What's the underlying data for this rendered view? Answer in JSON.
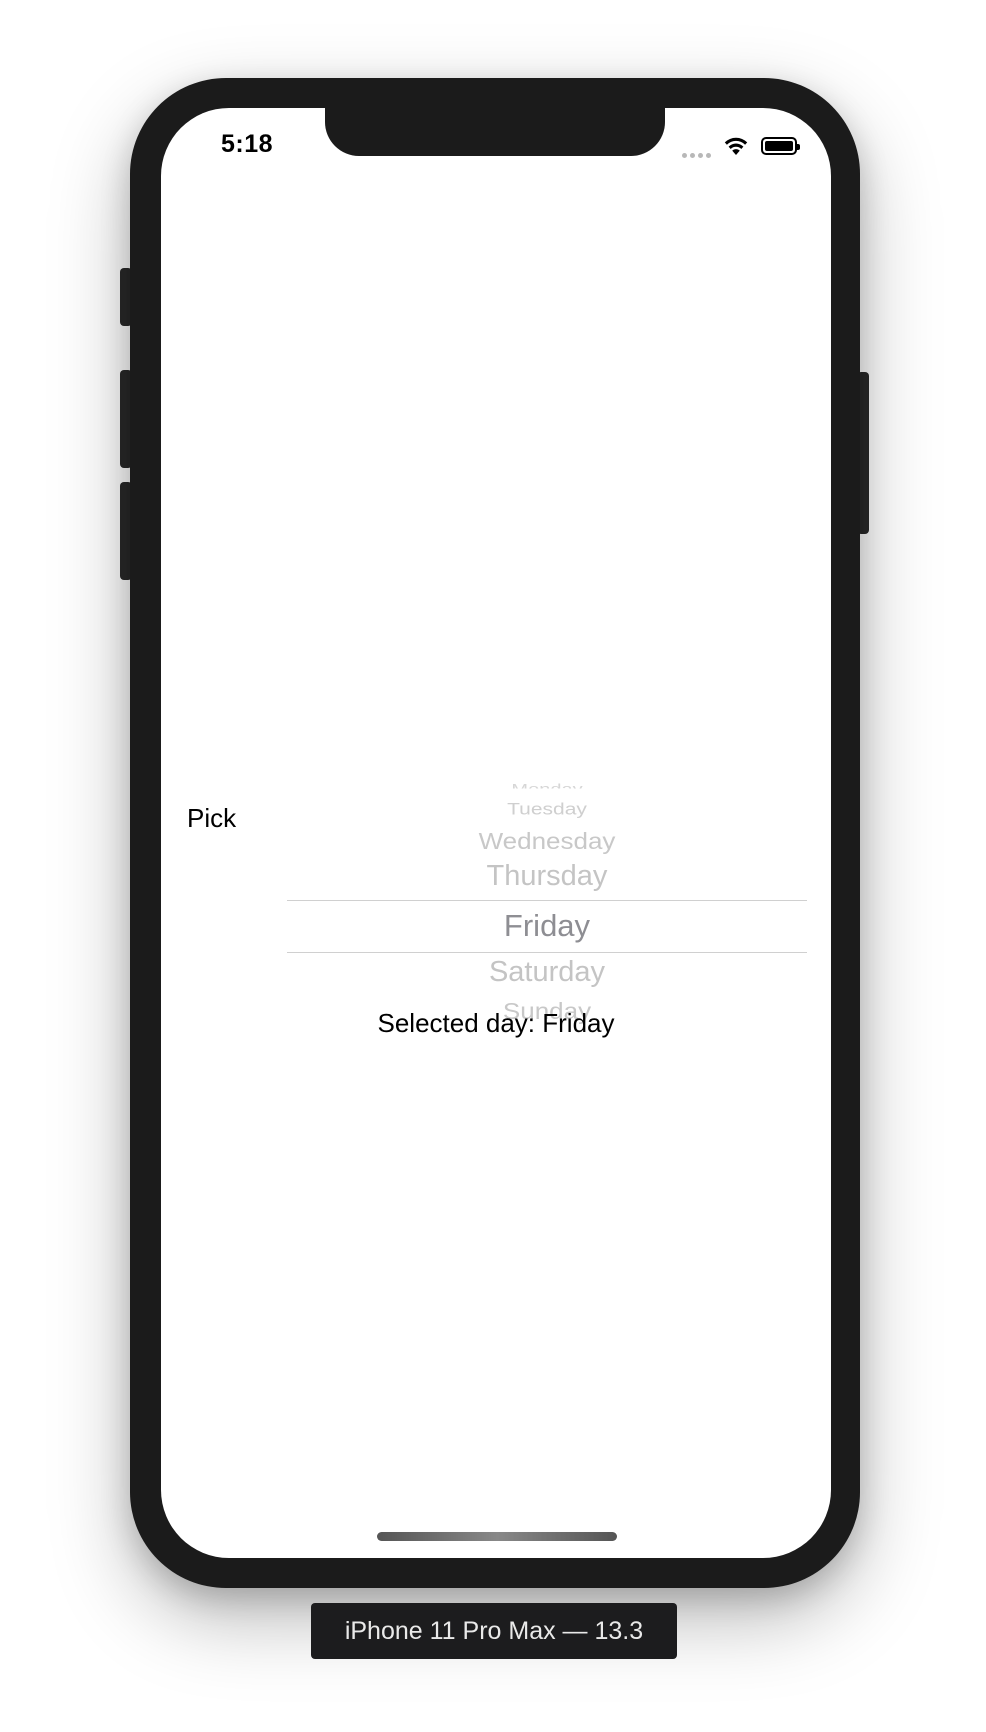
{
  "status_bar": {
    "time": "5:18",
    "signal_icon": "cellular-dots-icon",
    "wifi_icon": "wifi-icon",
    "battery_icon": "battery-icon"
  },
  "form": {
    "pick_label": "Pick",
    "picker": {
      "items": [
        "Monday",
        "Tuesday",
        "Wednesday",
        "Thursday",
        "Friday",
        "Saturday",
        "Sunday"
      ],
      "selected": "Friday"
    },
    "selected_prefix": "Selected day: ",
    "selected_value": "Friday"
  },
  "simulator": {
    "device_label": "iPhone 11 Pro Max — 13.3"
  }
}
